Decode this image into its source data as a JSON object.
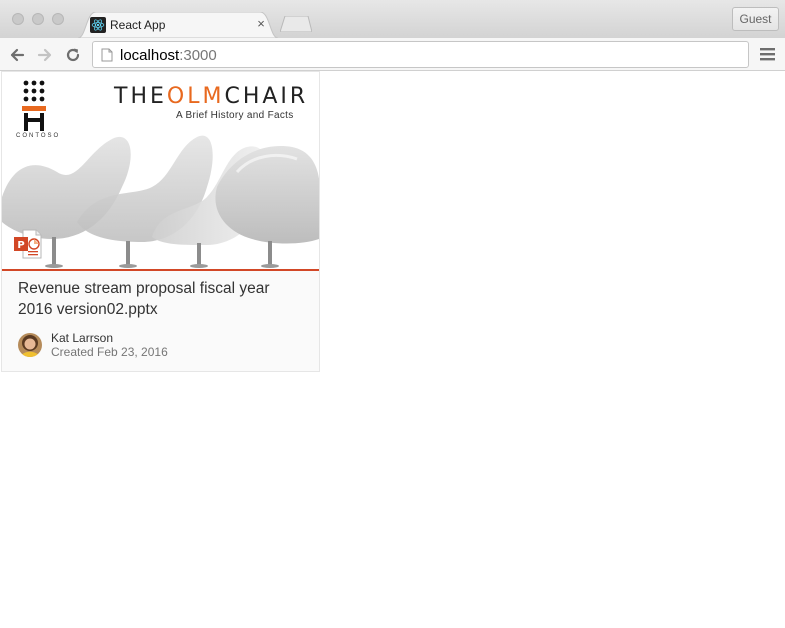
{
  "browser": {
    "tab_title": "React App",
    "tab_close": "×",
    "profile_button": "Guest",
    "url_host": "localhost",
    "url_port": ":3000"
  },
  "card": {
    "preview": {
      "brand_prefix": "THE",
      "brand_accent": "OLM",
      "brand_suffix": "CHAIR",
      "tagline": "A Brief History and Facts",
      "logo_word": "CONTOSO"
    },
    "title": "Revenue stream proposal fiscal year 2016 version02.pptx",
    "author": "Kat Larrson",
    "created": "Created Feb 23, 2016",
    "file_type_icon": "powerpoint-icon"
  },
  "colors": {
    "accent": "#e8691f",
    "powerpoint": "#d24726"
  }
}
